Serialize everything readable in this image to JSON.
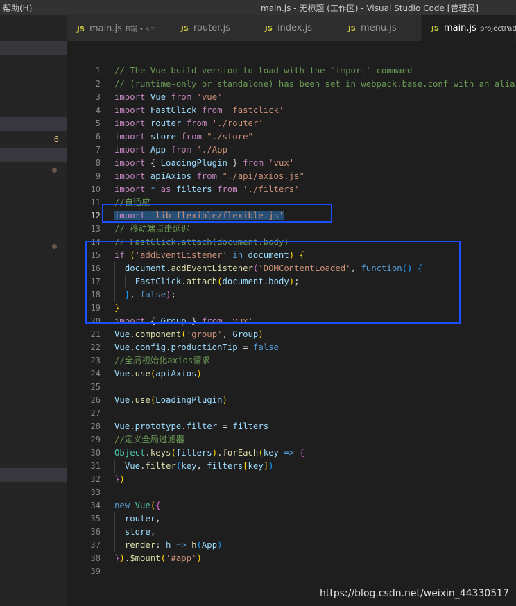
{
  "window": {
    "menu_help": "帮助(H)",
    "title": "main.js - 无标题 (工作区) - Visual Studio Code [管理员]"
  },
  "sidebar": {
    "badge_count": "6"
  },
  "tabs": [
    {
      "icon_label": "JS",
      "label": "main.js",
      "desc": "B端 • src"
    },
    {
      "icon_label": "JS",
      "label": "router.js",
      "desc": ""
    },
    {
      "icon_label": "JS",
      "label": "index.js",
      "desc": ""
    },
    {
      "icon_label": "JS",
      "label": "menu.js",
      "desc": ""
    },
    {
      "icon_label": "JS",
      "label": "main.js",
      "desc": "projectPath"
    }
  ],
  "editor": {
    "current_line": 12,
    "lines": [
      [
        [
          "c",
          "// The Vue build version to load with the `import` command"
        ]
      ],
      [
        [
          "c",
          "// (runtime-only or standalone) has been set in webpack.base.conf with an alias."
        ]
      ],
      [
        [
          "k",
          "import"
        ],
        [
          "p",
          " "
        ],
        [
          "v",
          "Vue"
        ],
        [
          "p",
          " "
        ],
        [
          "k",
          "from"
        ],
        [
          "p",
          " "
        ],
        [
          "s",
          "'vue'"
        ]
      ],
      [
        [
          "k",
          "import"
        ],
        [
          "p",
          " "
        ],
        [
          "v",
          "FastClick"
        ],
        [
          "p",
          " "
        ],
        [
          "k",
          "from"
        ],
        [
          "p",
          " "
        ],
        [
          "s",
          "'fastclick'"
        ]
      ],
      [
        [
          "k",
          "import"
        ],
        [
          "p",
          " "
        ],
        [
          "v",
          "router"
        ],
        [
          "p",
          " "
        ],
        [
          "k",
          "from"
        ],
        [
          "p",
          " "
        ],
        [
          "s",
          "'./router'"
        ]
      ],
      [
        [
          "k",
          "import"
        ],
        [
          "p",
          " "
        ],
        [
          "v",
          "store"
        ],
        [
          "p",
          " "
        ],
        [
          "k",
          "from"
        ],
        [
          "p",
          " "
        ],
        [
          "s",
          "\"./store\""
        ]
      ],
      [
        [
          "k",
          "import"
        ],
        [
          "p",
          " "
        ],
        [
          "v",
          "App"
        ],
        [
          "p",
          " "
        ],
        [
          "k",
          "from"
        ],
        [
          "p",
          " "
        ],
        [
          "s",
          "'./App'"
        ]
      ],
      [
        [
          "k",
          "import"
        ],
        [
          "p",
          " "
        ],
        [
          "p",
          "{ "
        ],
        [
          "v",
          "LoadingPlugin"
        ],
        [
          "p",
          " } "
        ],
        [
          "k",
          "from"
        ],
        [
          "p",
          " "
        ],
        [
          "s",
          "'vux'"
        ]
      ],
      [
        [
          "k",
          "import"
        ],
        [
          "p",
          " "
        ],
        [
          "v",
          "apiAxios"
        ],
        [
          "p",
          " "
        ],
        [
          "k",
          "from"
        ],
        [
          "p",
          " "
        ],
        [
          "s",
          "\"./api/axios.js\""
        ]
      ],
      [
        [
          "k",
          "import"
        ],
        [
          "p",
          " "
        ],
        [
          "b",
          "*"
        ],
        [
          "p",
          " "
        ],
        [
          "k",
          "as"
        ],
        [
          "p",
          " "
        ],
        [
          "v",
          "filters"
        ],
        [
          "p",
          " "
        ],
        [
          "k",
          "from"
        ],
        [
          "p",
          " "
        ],
        [
          "s",
          "'./filters'"
        ]
      ],
      [
        [
          "c",
          "//自适应"
        ]
      ],
      [
        [
          "k",
          "import"
        ],
        [
          "p",
          " "
        ],
        [
          "s",
          "'lib-flexible/flexible.js'"
        ]
      ],
      [
        [
          "c",
          "// 移动端点击延迟"
        ]
      ],
      [
        [
          "c",
          "// FastClick.attach(document.body)"
        ]
      ],
      [
        [
          "k",
          "if"
        ],
        [
          "p",
          " "
        ],
        [
          "br1",
          "("
        ],
        [
          "s",
          "'addEventListener'"
        ],
        [
          "p",
          " "
        ],
        [
          "b",
          "in"
        ],
        [
          "p",
          " "
        ],
        [
          "v",
          "document"
        ],
        [
          "br1",
          ")"
        ],
        [
          "p",
          " "
        ],
        [
          "br1",
          "{"
        ]
      ],
      [
        [
          "p",
          "  "
        ],
        [
          "v",
          "document"
        ],
        [
          "p",
          "."
        ],
        [
          "f",
          "addEventListener"
        ],
        [
          "br2",
          "("
        ],
        [
          "s",
          "'DOMContentLoaded'"
        ],
        [
          "p",
          ", "
        ],
        [
          "b",
          "function"
        ],
        [
          "br3",
          "()"
        ],
        [
          "p",
          " "
        ],
        [
          "br3",
          "{"
        ]
      ],
      [
        [
          "p",
          "    "
        ],
        [
          "v",
          "FastClick"
        ],
        [
          "p",
          "."
        ],
        [
          "f",
          "attach"
        ],
        [
          "br1",
          "("
        ],
        [
          "v",
          "document"
        ],
        [
          "p",
          "."
        ],
        [
          "v",
          "body"
        ],
        [
          "br1",
          ")"
        ],
        [
          "p",
          ";"
        ]
      ],
      [
        [
          "p",
          "  "
        ],
        [
          "br3",
          "}"
        ],
        [
          "p",
          ", "
        ],
        [
          "b",
          "false"
        ],
        [
          "br2",
          ")"
        ],
        [
          "p",
          ";"
        ]
      ],
      [
        [
          "br1",
          "}"
        ]
      ],
      [
        [
          "k",
          "import"
        ],
        [
          "p",
          " "
        ],
        [
          "p",
          "{ "
        ],
        [
          "v",
          "Group"
        ],
        [
          "p",
          " } "
        ],
        [
          "k",
          "from"
        ],
        [
          "p",
          " "
        ],
        [
          "s",
          "'vux'"
        ]
      ],
      [
        [
          "v",
          "Vue"
        ],
        [
          "p",
          "."
        ],
        [
          "f",
          "component"
        ],
        [
          "br1",
          "("
        ],
        [
          "s",
          "'group'"
        ],
        [
          "p",
          ", "
        ],
        [
          "v",
          "Group"
        ],
        [
          "br1",
          ")"
        ]
      ],
      [
        [
          "v",
          "Vue"
        ],
        [
          "p",
          "."
        ],
        [
          "v",
          "config"
        ],
        [
          "p",
          "."
        ],
        [
          "v",
          "productionTip"
        ],
        [
          "p",
          " = "
        ],
        [
          "b",
          "false"
        ]
      ],
      [
        [
          "c",
          "//全局初始化axios请求"
        ]
      ],
      [
        [
          "v",
          "Vue"
        ],
        [
          "p",
          "."
        ],
        [
          "f",
          "use"
        ],
        [
          "br1",
          "("
        ],
        [
          "v",
          "apiAxios"
        ],
        [
          "br1",
          ")"
        ]
      ],
      [],
      [
        [
          "v",
          "Vue"
        ],
        [
          "p",
          "."
        ],
        [
          "f",
          "use"
        ],
        [
          "br1",
          "("
        ],
        [
          "v",
          "LoadingPlugin"
        ],
        [
          "br1",
          ")"
        ]
      ],
      [],
      [
        [
          "v",
          "Vue"
        ],
        [
          "p",
          "."
        ],
        [
          "v",
          "prototype"
        ],
        [
          "p",
          "."
        ],
        [
          "v",
          "filter"
        ],
        [
          "p",
          " = "
        ],
        [
          "v",
          "filters"
        ]
      ],
      [
        [
          "c",
          "//定义全局过滤器"
        ]
      ],
      [
        [
          "t",
          "Object"
        ],
        [
          "p",
          "."
        ],
        [
          "f",
          "keys"
        ],
        [
          "br1",
          "("
        ],
        [
          "v",
          "filters"
        ],
        [
          "br1",
          ")"
        ],
        [
          "p",
          "."
        ],
        [
          "f",
          "forEach"
        ],
        [
          "br1",
          "("
        ],
        [
          "v",
          "key"
        ],
        [
          "p",
          " "
        ],
        [
          "b",
          "=>"
        ],
        [
          "p",
          " "
        ],
        [
          "br2",
          "{"
        ]
      ],
      [
        [
          "p",
          "  "
        ],
        [
          "v",
          "Vue"
        ],
        [
          "p",
          "."
        ],
        [
          "f",
          "filter"
        ],
        [
          "br3",
          "("
        ],
        [
          "v",
          "key"
        ],
        [
          "p",
          ", "
        ],
        [
          "v",
          "filters"
        ],
        [
          "br1",
          "["
        ],
        [
          "v",
          "key"
        ],
        [
          "br1",
          "]"
        ],
        [
          "br3",
          ")"
        ]
      ],
      [
        [
          "br2",
          "}"
        ],
        [
          "br1",
          ")"
        ]
      ],
      [],
      [
        [
          "b",
          "new"
        ],
        [
          "p",
          " "
        ],
        [
          "t",
          "Vue"
        ],
        [
          "br1",
          "("
        ],
        [
          "br2",
          "{"
        ]
      ],
      [
        [
          "p",
          "  "
        ],
        [
          "v",
          "router"
        ],
        [
          "p",
          ","
        ]
      ],
      [
        [
          "p",
          "  "
        ],
        [
          "v",
          "store"
        ],
        [
          "p",
          ","
        ]
      ],
      [
        [
          "p",
          "  "
        ],
        [
          "f",
          "render"
        ],
        [
          "p",
          ": "
        ],
        [
          "v",
          "h"
        ],
        [
          "p",
          " "
        ],
        [
          "b",
          "=>"
        ],
        [
          "p",
          " "
        ],
        [
          "f",
          "h"
        ],
        [
          "br3",
          "("
        ],
        [
          "v",
          "App"
        ],
        [
          "br3",
          ")"
        ]
      ],
      [
        [
          "br2",
          "}"
        ],
        [
          "br1",
          ")"
        ],
        [
          "p",
          "."
        ],
        [
          "f",
          "$mount"
        ],
        [
          "br1",
          "("
        ],
        [
          "s",
          "'#app'"
        ],
        [
          "br1",
          ")"
        ]
      ],
      []
    ]
  },
  "watermark": "https://blog.csdn.net/weixin_44330517",
  "colors": {
    "accent_box": "#1a50ff",
    "selection": "#264f78"
  }
}
